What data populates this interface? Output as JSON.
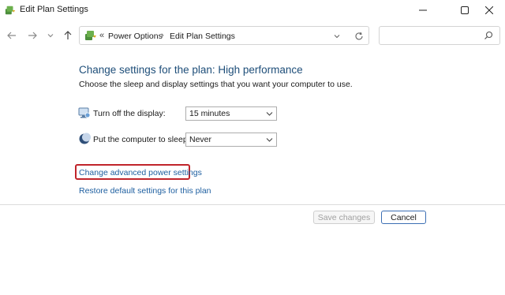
{
  "window": {
    "title": "Edit Plan Settings"
  },
  "address": {
    "overflow": "«",
    "crumbs": [
      "Power Options",
      "Edit Plan Settings"
    ],
    "separator": "›"
  },
  "search": {
    "placeholder": ""
  },
  "main": {
    "heading": "Change settings for the plan: High performance",
    "subheading": "Choose the sleep and display settings that you want your computer to use.",
    "settings": [
      {
        "label": "Turn off the display:",
        "value": "15 minutes",
        "icon": "monitor-icon"
      },
      {
        "label": "Put the computer to sleep:",
        "value": "Never",
        "icon": "moon-icon"
      }
    ],
    "links": {
      "advanced": "Change advanced power settings",
      "restore": "Restore default settings for this plan"
    }
  },
  "footer": {
    "save_label": "Save changes",
    "cancel_label": "Cancel"
  },
  "colors": {
    "heading": "#1e4e79",
    "link": "#1e5fa0",
    "highlight_box": "#c0242b"
  }
}
